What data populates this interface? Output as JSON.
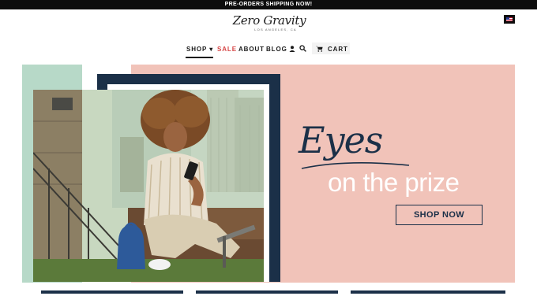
{
  "announcement": {
    "text": "PRE-ORDERS SHIPPING NOW!"
  },
  "header": {
    "logo_script": "Zero Gravity",
    "logo_tagline": "LOS ANGELES, CA",
    "flag_icon": "us-flag-icon"
  },
  "nav": {
    "items": [
      {
        "label": "SHOP",
        "active": true
      },
      {
        "label": "SALE",
        "color": "#d64545"
      },
      {
        "label": "ABOUT"
      },
      {
        "label": "BLOG"
      }
    ],
    "icons": [
      "user-icon",
      "search-icon",
      "cart-icon"
    ],
    "cart_label": "CART"
  },
  "hero": {
    "headline_script": "Eyes",
    "headline_sub": "on the prize",
    "cta_label": "SHOP NOW",
    "colors": {
      "pink": "#f1c3b9",
      "mint": "#b7d9c8",
      "navy": "#1b3048",
      "sale_red": "#d64545"
    }
  }
}
